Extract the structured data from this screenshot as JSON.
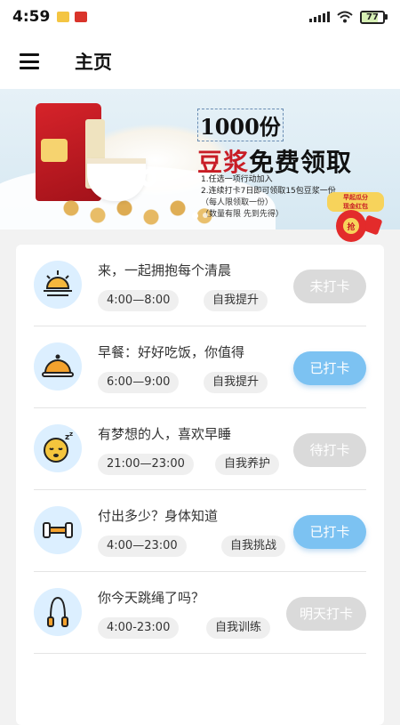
{
  "status": {
    "time": "4:59",
    "battery": "77"
  },
  "app_bar": {
    "title": "主页"
  },
  "banner": {
    "headline_1": "1000份",
    "headline_2_red": "豆浆",
    "headline_2_black": "免费领取",
    "rule_1": "1.任选一项行动加入",
    "rule_2": "2.连续打卡7日即可领取15包豆浆一份",
    "rule_3": "（每人限领取一份）",
    "rule_4": "（数量有限 先到先得）",
    "envelope_text_1": "早起瓜分",
    "envelope_text_2": "现金红包",
    "envelope_coin": "抢"
  },
  "tasks": [
    {
      "title": "来，一起拥抱每个清晨",
      "time": "4:00—8:00",
      "category": "自我提升",
      "status": "未打卡",
      "icon": "sunrise-icon"
    },
    {
      "title": "早餐：好好吃饭，你值得",
      "time": "6:00—9:00",
      "category": "自我提升",
      "status": "已打卡",
      "icon": "dish-cloche-icon"
    },
    {
      "title": "有梦想的人，喜欢早睡",
      "time": "21:00—23:00",
      "category": "自我养护",
      "status": "待打卡",
      "icon": "sleeping-face-icon"
    },
    {
      "title": "付出多少？身体知道",
      "time": "4:00—23:00",
      "category": "自我挑战",
      "status": "已打卡",
      "icon": "dumbbell-icon"
    },
    {
      "title": "你今天跳绳了吗？",
      "time": "4:00-23:00",
      "category": "自我训练",
      "status": "明天打卡",
      "icon": "jump-rope-icon"
    }
  ],
  "colors": {
    "checked": "#7cc2f2",
    "unchecked": "#dadada",
    "icon_bg": "#dcefff",
    "accent_red": "#c81d25"
  }
}
